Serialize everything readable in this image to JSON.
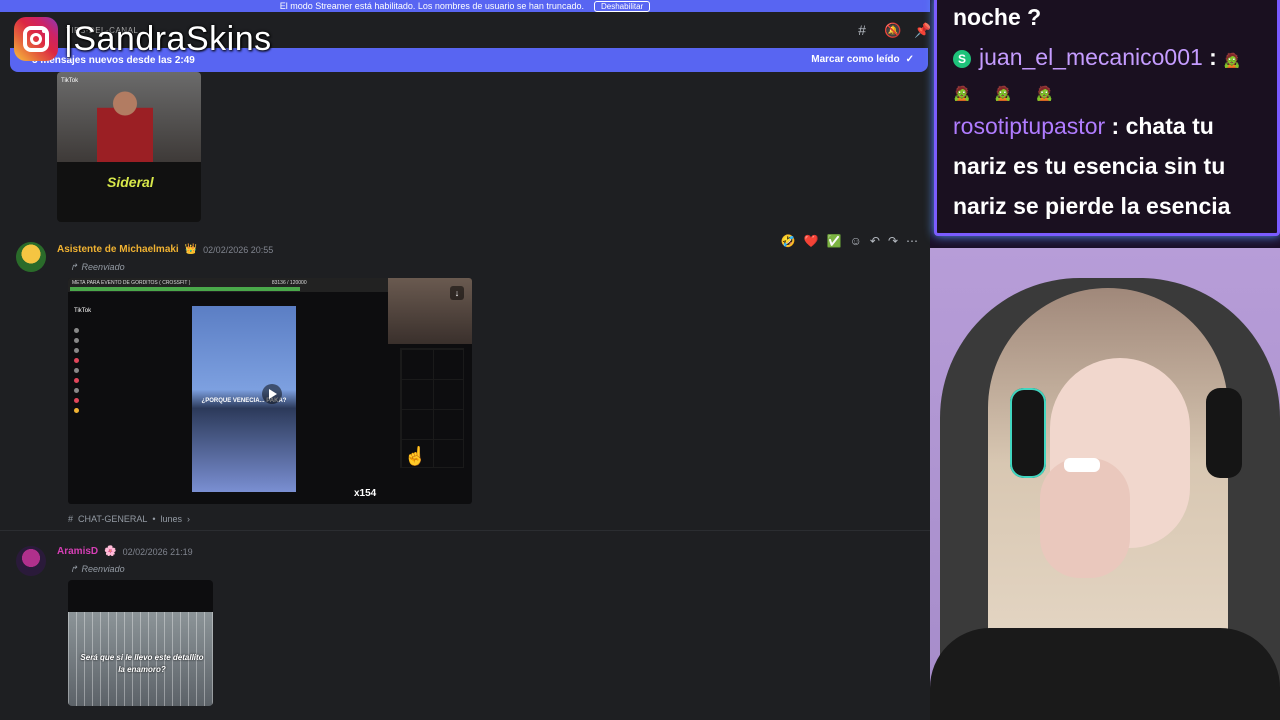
{
  "overlay": {
    "instagram_handle": "|SandraSkins",
    "icon": "instagram-icon"
  },
  "discord": {
    "streamer_bar": {
      "text": "El modo Streamer está habilitado. Los nombres de usuario se han truncado.",
      "button": "Deshabilitar"
    },
    "channel_name": "TIPS-DEL-CANAL",
    "new_messages": {
      "text": "5 mensajes nuevos desde las 2:49",
      "action": "Marcar como leído"
    },
    "messages": [
      {
        "author": "Asistente de Michaelmaki",
        "author_color": "#f0b232",
        "badge": "👑",
        "date": "02/02/2026 20:55",
        "forwarded": "Reenviado",
        "embed": {
          "top_title": "META PARA EVENTO DE GORDITOS ( CROSSFIT )",
          "progress_text": "83136 / 120000",
          "sidebar_title": "TikTok",
          "video_caption": "¿PORQUE VENECIA... PAKA?",
          "count": "x154"
        },
        "channel_ref": {
          "channel": "CHAT-GENERAL",
          "when": "lunes"
        }
      },
      {
        "author": "AramisD",
        "author_color": "#d63fb5",
        "badge": "🌸",
        "date": "02/02/2026 21:19",
        "forwarded": "Reenviado",
        "embed": {
          "caption": "Será que si le llevo este detallito la enamoro?"
        }
      }
    ],
    "thumb_top": {
      "tiktok": "TikTok",
      "logo": "Sideral"
    },
    "reactions": [
      "🤣",
      "❤️",
      "✅"
    ],
    "header_icons": [
      "threads-icon",
      "mute-icon",
      "pin-icon"
    ]
  },
  "stream_chat": {
    "partial_line": "noche ?",
    "lines": [
      {
        "user": "juan_el_mecanico001",
        "sep": " : ",
        "text": "🧟",
        "badge": "S"
      },
      {
        "emotes": "🧟 🧟 🧟"
      },
      {
        "user": "rosotiptupastor",
        "sep": " : ",
        "text": "chata tu nariz es tu esencia sin tu nariz se pierde la esencia"
      }
    ]
  }
}
